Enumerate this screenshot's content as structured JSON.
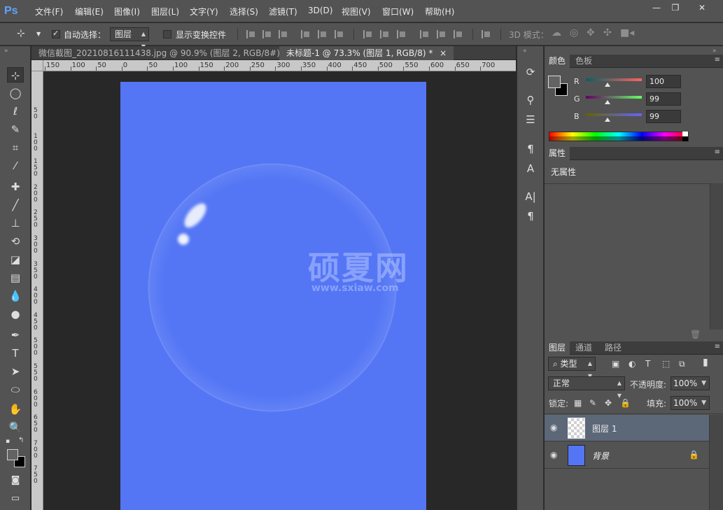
{
  "app": {
    "logo": "Ps"
  },
  "menu": [
    "文件(F)",
    "编辑(E)",
    "图像(I)",
    "图层(L)",
    "文字(Y)",
    "选择(S)",
    "滤镜(T)",
    "3D(D)",
    "视图(V)",
    "窗口(W)",
    "帮助(H)"
  ],
  "window_controls": {
    "minimize": "—",
    "restore": "❐",
    "close": "✕"
  },
  "options_bar": {
    "auto_select_label": "自动选择：",
    "auto_select_checked": true,
    "auto_select_value": "图层",
    "show_transform_label": "显示变换控件",
    "show_transform_checked": false,
    "mode_3d_label": "3D 模式："
  },
  "tabs": [
    {
      "label": "微信截图_20210816111438.jpg @ 90.9% (图层 2, RGB/8#) *",
      "close": "×",
      "active": false
    },
    {
      "label": "未标题-1 @ 73.3% (图层 1, RGB/8) *",
      "close": "×",
      "active": true
    }
  ],
  "ruler_h": [
    "150",
    "100",
    "50",
    "0",
    "50",
    "100",
    "150",
    "200",
    "250",
    "300",
    "350",
    "400",
    "450",
    "500",
    "550",
    "600",
    "650",
    "700"
  ],
  "ruler_v": [
    "5 0",
    "1 0 0",
    "1 5 0",
    "2 0 0",
    "2 5 0",
    "3 0 0",
    "3 5 0",
    "4 0 0",
    "4 5 0",
    "5 0 0",
    "5 5 0",
    "6 0 0",
    "6 5 0",
    "7 0 0",
    "7 5 0"
  ],
  "canvas": {
    "background": "#5476f5",
    "watermark_cn": "硕夏网",
    "watermark_en": "www.sxiaw.com"
  },
  "color_panel": {
    "tabs": [
      "颜色",
      "色板"
    ],
    "r_label": "R",
    "r_value": "100",
    "g_label": "G",
    "g_value": "99",
    "b_label": "B",
    "b_value": "99"
  },
  "properties_panel": {
    "tab": "属性",
    "text": "无属性"
  },
  "layers_panel": {
    "tabs": [
      "图层",
      "通道",
      "路径"
    ],
    "filter_kind": "类型",
    "blend_mode": "正常",
    "opacity_label": "不透明度:",
    "opacity_value": "100%",
    "lock_label": "锁定:",
    "fill_label": "填充:",
    "fill_value": "100%",
    "layers": [
      {
        "name": "图层 1",
        "selected": true
      },
      {
        "name": "背景",
        "selected": false,
        "locked": true
      }
    ]
  },
  "colors": {
    "accent": "#5ea4ff",
    "canvas_blue": "#5476f5",
    "panel": "#535353"
  }
}
